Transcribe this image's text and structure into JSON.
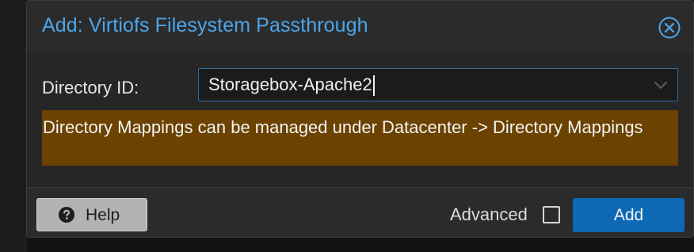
{
  "dialog": {
    "title": "Add: Virtiofs Filesystem Passthrough",
    "close_icon": "close-circle-icon"
  },
  "form": {
    "directory_id_label": "Directory ID:",
    "directory_id_value": "Storagebox-Apache2",
    "dropdown_icon": "chevron-down-icon"
  },
  "notice": {
    "text": "Directory Mappings can be managed under Datacenter -> Directory Mappings"
  },
  "footer": {
    "help_label": "Help",
    "help_icon": "question-circle-icon",
    "advanced_label": "Advanced",
    "advanced_checked": false,
    "add_label": "Add"
  },
  "colors": {
    "title": "#4da6ea",
    "notice_bg": "#6b4200",
    "primary_button": "#0e69b5",
    "input_border": "#2f6da0"
  }
}
